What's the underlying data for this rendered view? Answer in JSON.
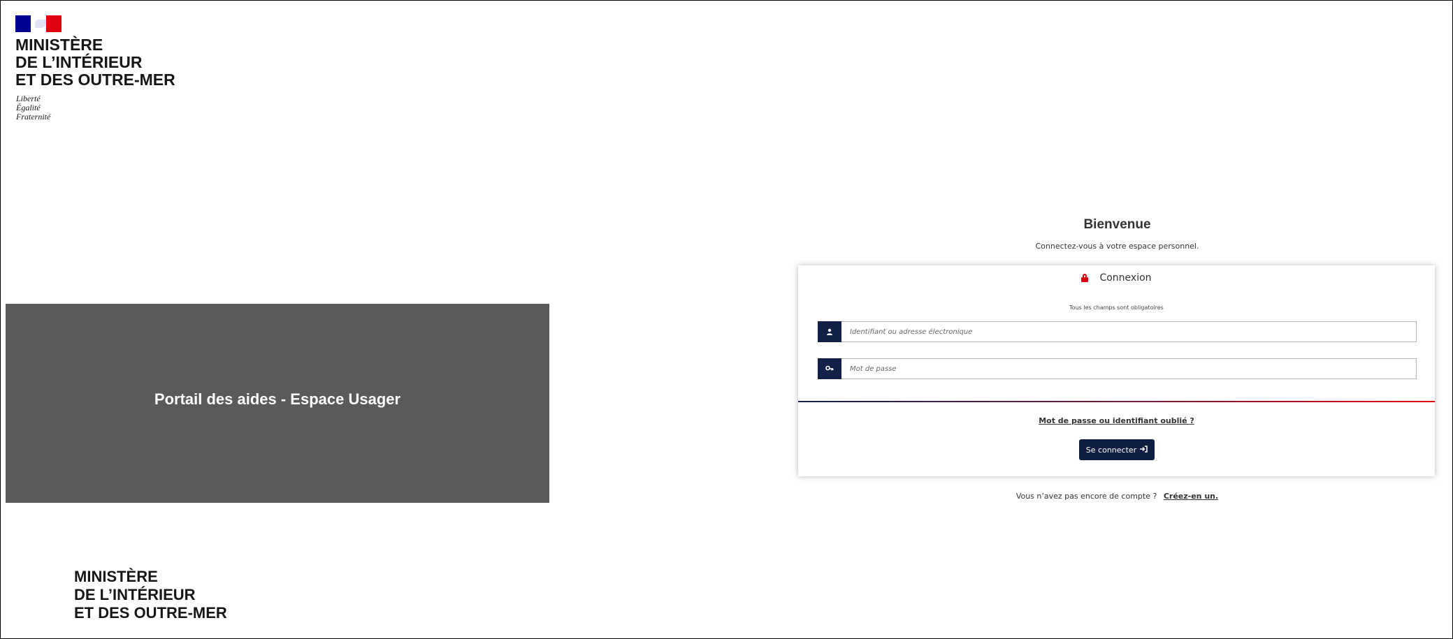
{
  "header": {
    "ministry_lines": [
      "MINISTÈRE",
      "DE L’INTÉRIEUR",
      "ET DES OUTRE-MER"
    ],
    "motto": [
      "Liberté",
      "Égalité",
      "Fraternité"
    ],
    "flag_icon": "marianne-flag-icon"
  },
  "hero": {
    "title": "Portail des aides - Espace Usager",
    "background": "#5a5a5a"
  },
  "welcome": {
    "title": "Bienvenue",
    "subtitle": "Connectez-vous à votre espace personnel."
  },
  "login": {
    "heading": "Connexion",
    "heading_icon": "lock-icon",
    "required_note": "Tous les champs sont obligatoires",
    "username": {
      "placeholder": "Identifiant ou adresse électronique",
      "value": "",
      "icon": "user-icon"
    },
    "password": {
      "placeholder": "Mot de passe",
      "value": "",
      "icon": "key-icon"
    },
    "forgot_link": "Mot de passe ou identifiant oublié ?",
    "submit_label": "Se connecter",
    "submit_icon": "sign-in-icon"
  },
  "signup": {
    "prompt": "Vous n’avez pas encore de compte ?",
    "link": "Créez-en un."
  },
  "footer": {
    "ministry_lines": [
      "MINISTÈRE",
      "DE L’INTÉRIEUR",
      "ET DES OUTRE-MER"
    ]
  },
  "colors": {
    "navy": "#122047",
    "red": "#e1000f",
    "button": "#0f1e40"
  }
}
